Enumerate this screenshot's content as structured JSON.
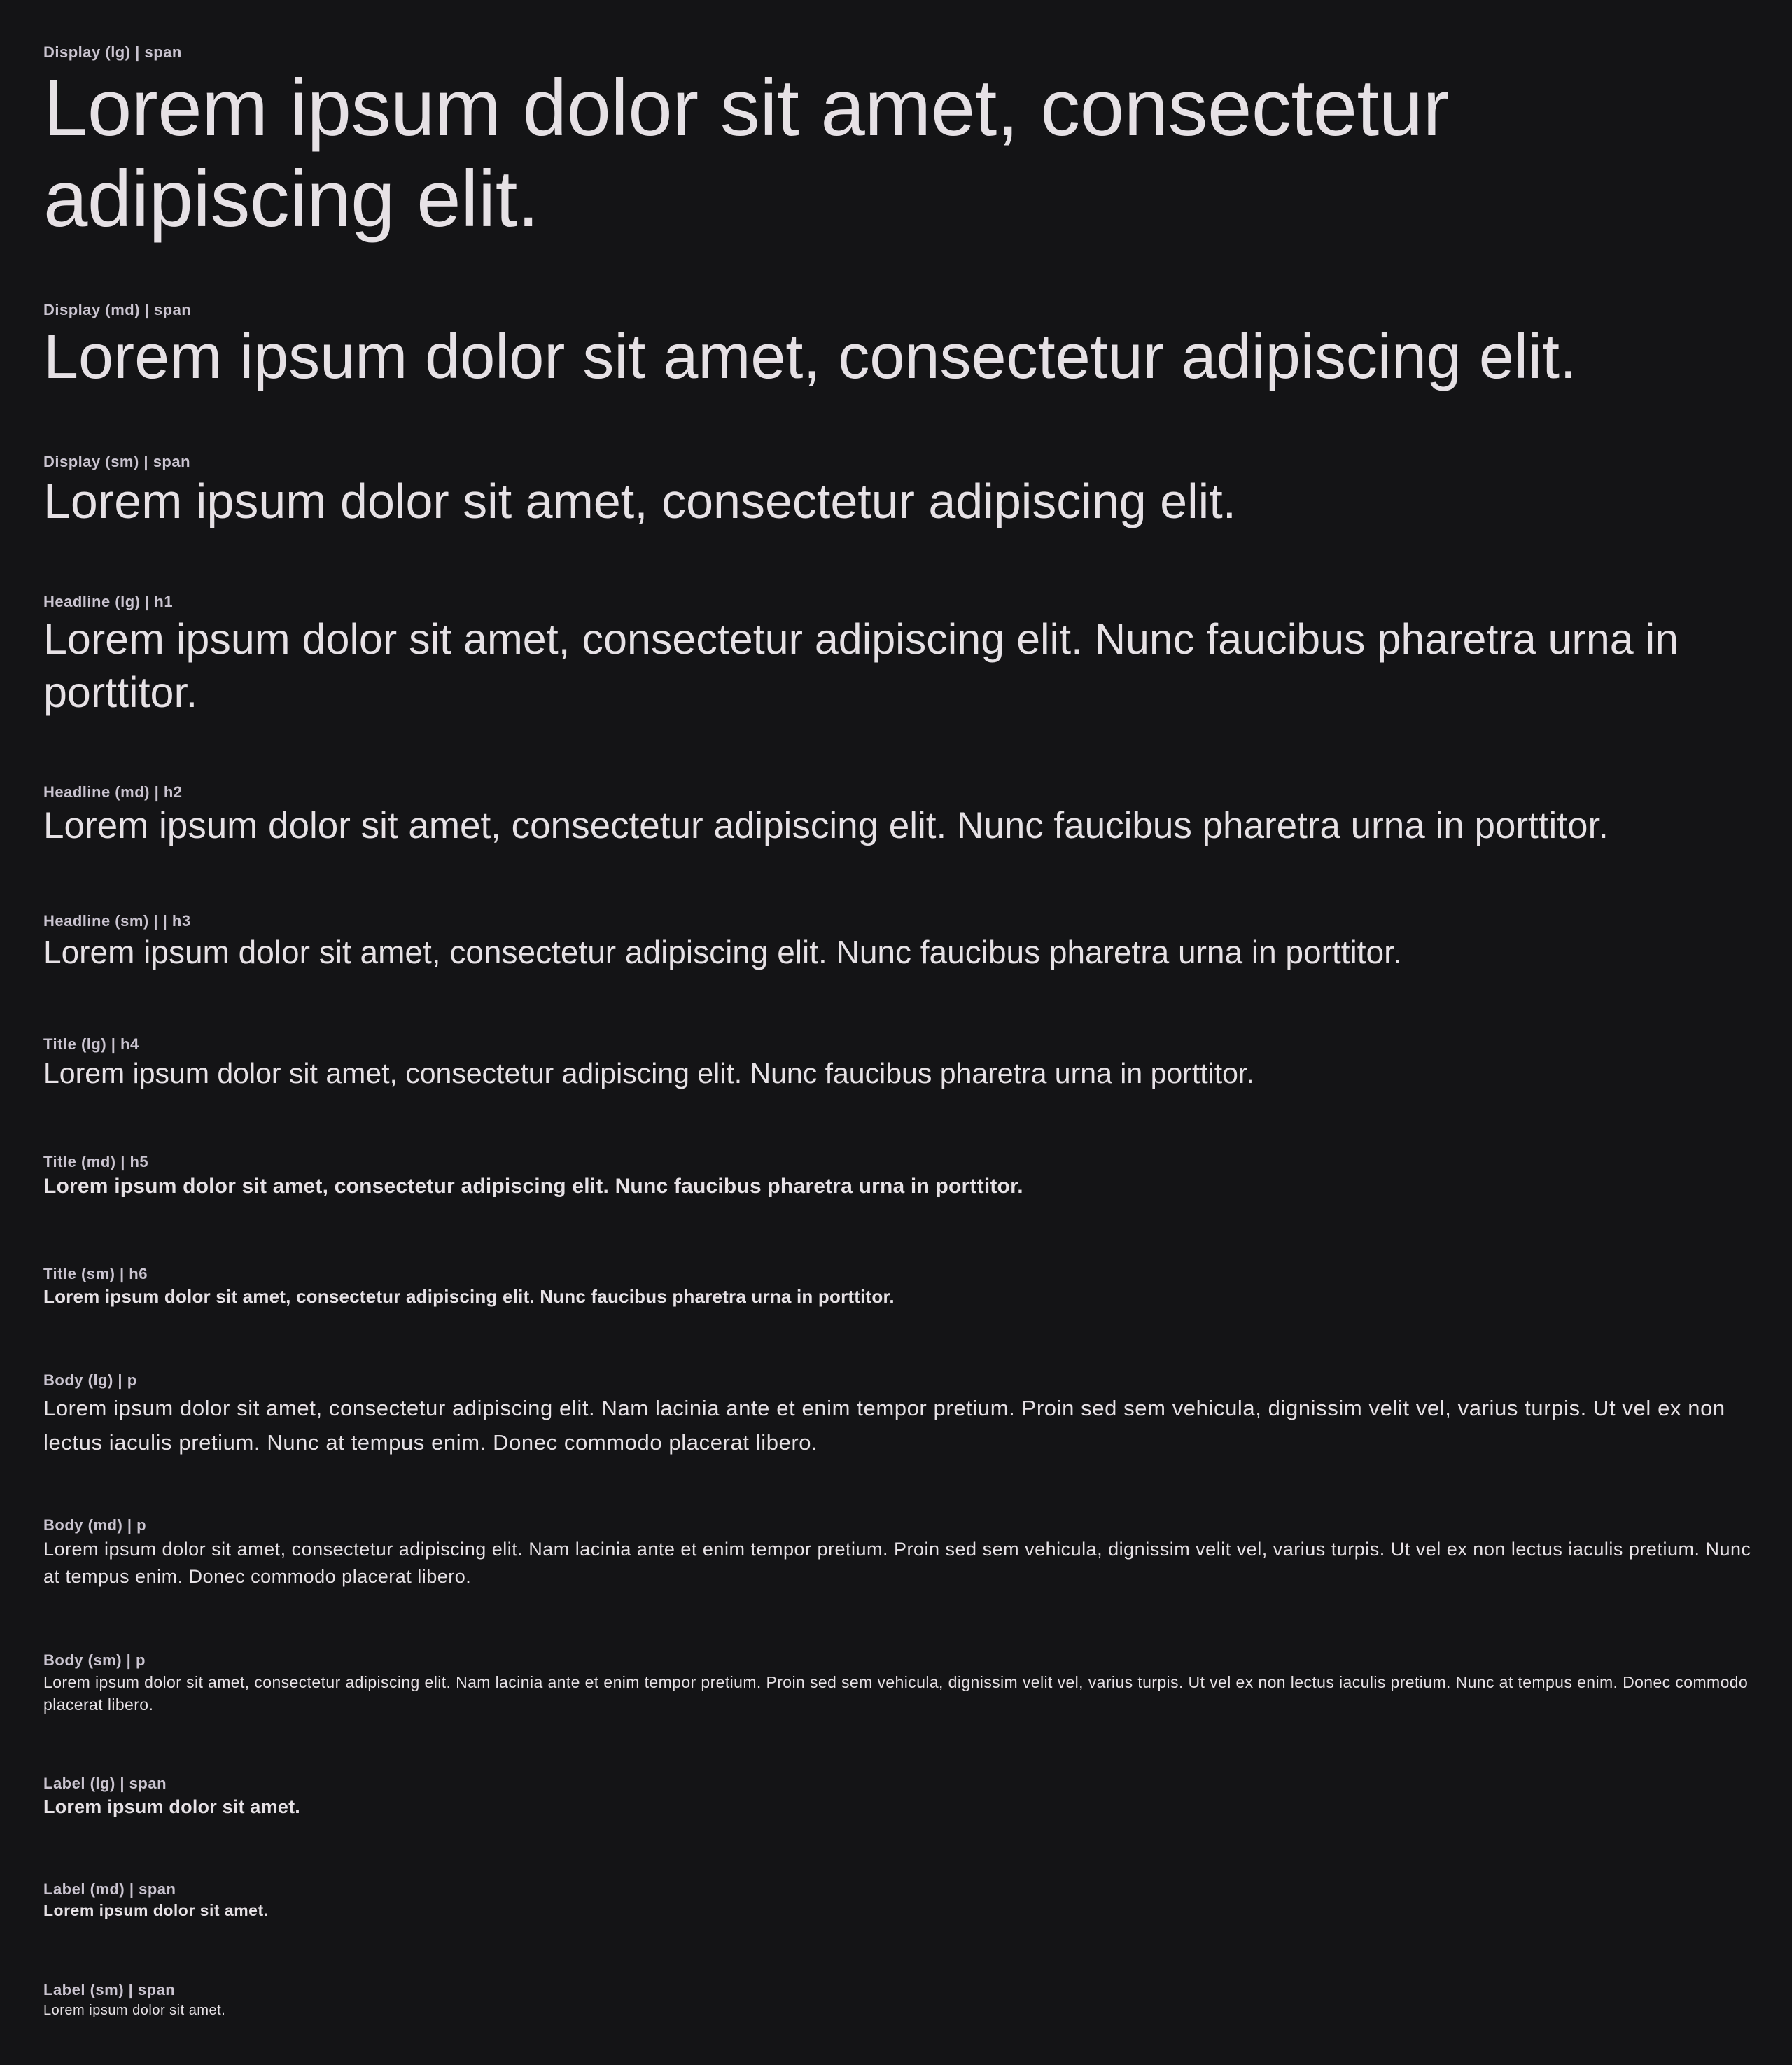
{
  "specimens": [
    {
      "tag": "Display (lg) | span",
      "text": "Lorem ipsum dolor sit amet, consectetur adipiscing elit."
    },
    {
      "tag": "Display (md) | span",
      "text": "Lorem ipsum dolor sit amet, consectetur adipiscing elit."
    },
    {
      "tag": "Display (sm) | span",
      "text": "Lorem ipsum dolor sit amet, consectetur adipiscing elit."
    },
    {
      "tag": "Headline (lg) | h1",
      "text": "Lorem ipsum dolor sit amet, consectetur adipiscing elit. Nunc faucibus pharetra urna in porttitor."
    },
    {
      "tag": "Headline (md) | h2",
      "text": "Lorem ipsum dolor sit amet, consectetur adipiscing elit. Nunc faucibus pharetra urna in porttitor."
    },
    {
      "tag": "Headline (sm) | | h3",
      "text": "Lorem ipsum dolor sit amet, consectetur adipiscing elit. Nunc faucibus pharetra urna in porttitor."
    },
    {
      "tag": "Title (lg) | h4",
      "text": "Lorem ipsum dolor sit amet, consectetur adipiscing elit. Nunc faucibus pharetra urna in porttitor."
    },
    {
      "tag": "Title (md) | h5",
      "text": "Lorem ipsum dolor sit amet, consectetur adipiscing elit. Nunc faucibus pharetra urna in porttitor."
    },
    {
      "tag": "Title (sm) | h6",
      "text": "Lorem ipsum dolor sit amet, consectetur adipiscing elit. Nunc faucibus pharetra urna in porttitor."
    },
    {
      "tag": "Body (lg) | p",
      "text": "Lorem ipsum dolor sit amet, consectetur adipiscing elit. Nam lacinia ante et enim tempor pretium. Proin sed sem vehicula, dignissim velit vel, varius turpis. Ut vel ex non lectus iaculis pretium. Nunc at tempus enim. Donec commodo placerat libero."
    },
    {
      "tag": "Body (md) | p",
      "text": "Lorem ipsum dolor sit amet, consectetur adipiscing elit. Nam lacinia ante et enim tempor pretium. Proin sed sem vehicula, dignissim velit vel, varius turpis. Ut vel ex non lectus iaculis pretium. Nunc at tempus enim. Donec commodo placerat libero."
    },
    {
      "tag": "Body (sm) | p",
      "text": "Lorem ipsum dolor sit amet, consectetur adipiscing elit. Nam lacinia ante et enim tempor pretium. Proin sed sem vehicula, dignissim velit vel, varius turpis. Ut vel ex non lectus iaculis pretium. Nunc at tempus enim. Donec commodo placerat libero."
    },
    {
      "tag": "Label (lg) | span",
      "text": "Lorem ipsum dolor sit amet."
    },
    {
      "tag": "Label (md) | span",
      "text": "Lorem ipsum dolor sit amet."
    },
    {
      "tag": "Label (sm) | span",
      "text": "Lorem ipsum dolor sit amet."
    }
  ]
}
